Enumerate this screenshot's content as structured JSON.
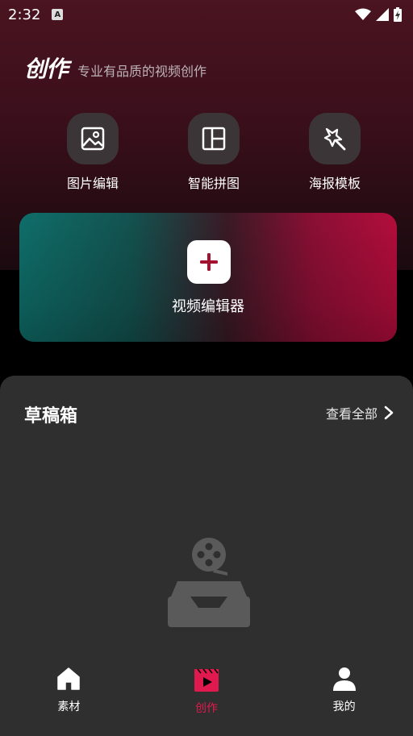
{
  "status_bar": {
    "time": "2:32",
    "notification_icon": "A"
  },
  "header": {
    "logo_text": "创作",
    "tagline": "专业有品质的视频创作"
  },
  "tools": [
    {
      "label": "图片编辑",
      "icon": "image-icon"
    },
    {
      "label": "智能拼图",
      "icon": "layout-grid-icon"
    },
    {
      "label": "海报模板",
      "icon": "magic-wand-icon"
    }
  ],
  "video_editor": {
    "label": "视频编辑器",
    "icon": "plus-icon"
  },
  "drafts": {
    "title": "草稿箱",
    "view_all": "查看全部"
  },
  "bottom_nav": [
    {
      "label": "素材",
      "icon": "home-icon",
      "active": false
    },
    {
      "label": "创作",
      "icon": "clapper-play-icon",
      "active": true
    },
    {
      "label": "我的",
      "icon": "user-icon",
      "active": false
    }
  ],
  "colors": {
    "accent": "#e0194f",
    "card_left": "#0f6e6a",
    "card_right": "#b40d3c",
    "panel": "#2f2f2f"
  }
}
